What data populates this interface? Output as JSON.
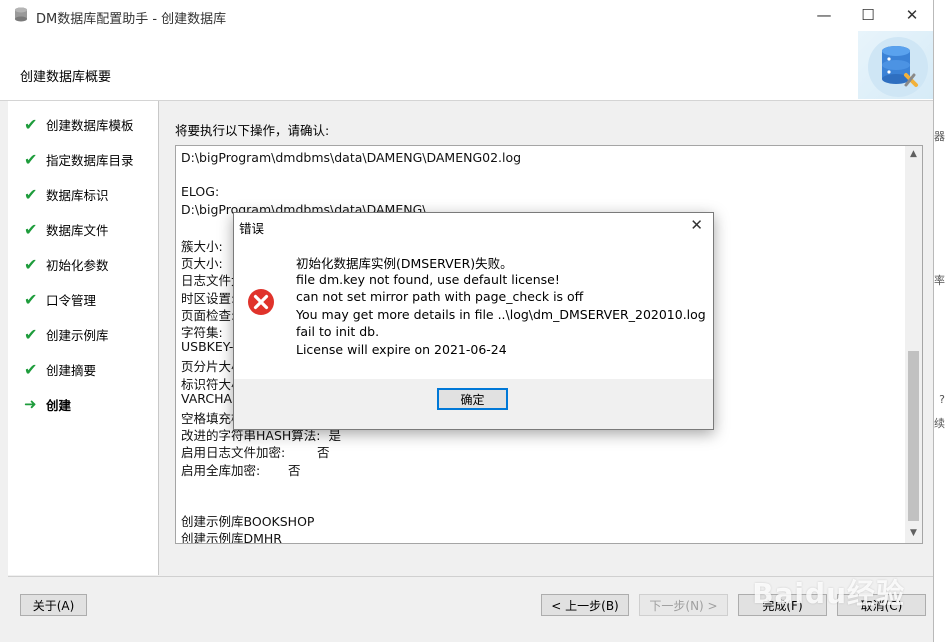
{
  "window": {
    "title": "DM数据库配置助手 - 创建数据库",
    "minimize": "—",
    "maximize": "☐",
    "close": "✕"
  },
  "header": {
    "title": "创建数据库概要"
  },
  "steps": [
    {
      "label": "创建数据库模板",
      "state": "done"
    },
    {
      "label": "指定数据库目录",
      "state": "done"
    },
    {
      "label": "数据库标识",
      "state": "done"
    },
    {
      "label": "数据库文件",
      "state": "done"
    },
    {
      "label": "初始化参数",
      "state": "done"
    },
    {
      "label": "口令管理",
      "state": "done"
    },
    {
      "label": "创建示例库",
      "state": "done"
    },
    {
      "label": "创建摘要",
      "state": "done"
    },
    {
      "label": "创建",
      "state": "current"
    }
  ],
  "main": {
    "confirm_label": "将要执行以下操作，请确认:",
    "summary_lines": [
      "D:\\bigProgram\\dmdbms\\data\\DAMENG\\DAMENG02.log",
      "",
      "ELOG:",
      "D:\\bigProgram\\dmdbms\\data\\DAMENG\\",
      "",
      "簇大小:",
      "页大小:",
      "日志文件大",
      "时区设置:",
      "页面检查:",
      "字符集:",
      "USBKEY-",
      "页分片大小",
      "标识符大小",
      "VARCHAR",
      "空格填充模",
      "改进的字符串HASH算法:  是",
      "启用日志文件加密:        否",
      "启用全库加密:       否",
      "",
      "",
      "创建示例库BOOKSHOP",
      "创建示例库DMHR"
    ]
  },
  "footer": {
    "about": "关于(A)",
    "back": "< 上一步(B)",
    "next": "下一步(N) >",
    "finish": "完成(F)",
    "cancel": "取消(C)"
  },
  "dialog": {
    "title": "错误",
    "close": "✕",
    "messages": [
      "初始化数据库实例(DMSERVER)失败。",
      "file dm.key not found, use default license!",
      "can not set mirror path with page_check is off",
      "You may get more details in file ..\\log\\dm_DMSERVER_202010.log",
      "fail to init db.",
      "License will expire on 2021-06-24"
    ],
    "ok": "确定"
  },
  "background": {
    "texts": [
      "器",
      "率",
      "?",
      "续"
    ]
  },
  "watermark": "Baidu经验",
  "colors": {
    "check": "#1e9c3c",
    "error_icon": "#e0332b",
    "focus_border": "#0078d7"
  }
}
